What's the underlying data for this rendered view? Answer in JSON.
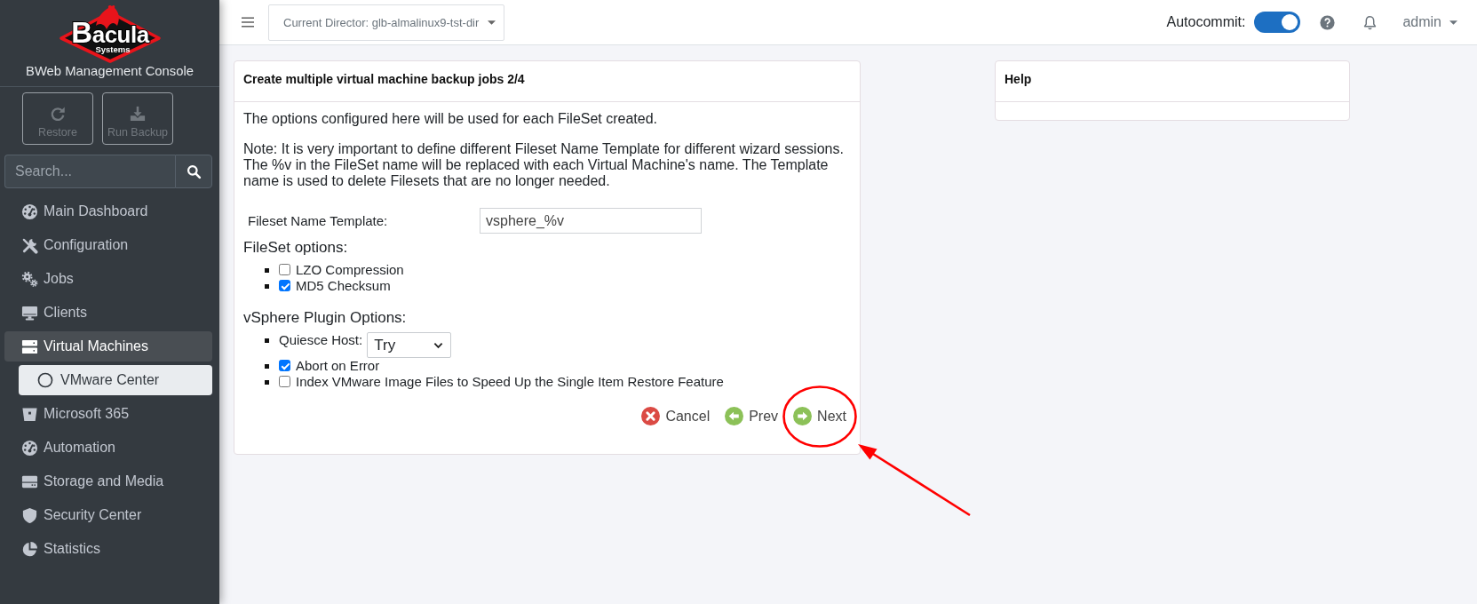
{
  "sidebar": {
    "logo": {
      "wordmark": "Bacula",
      "tagline": "Systems"
    },
    "title": "BWeb Management Console",
    "actions": [
      {
        "label": "Restore",
        "disabled": true
      },
      {
        "label": "Run Backup",
        "disabled": true
      }
    ],
    "search": {
      "placeholder": "Search..."
    },
    "menu": [
      {
        "label": "Main Dashboard",
        "selected": false
      },
      {
        "label": "Configuration",
        "selected": false
      },
      {
        "label": "Jobs",
        "selected": false
      },
      {
        "label": "Clients",
        "selected": false
      },
      {
        "label": "Virtual Machines",
        "selected": true,
        "children": [
          {
            "label": "VMware Center",
            "selected": true
          }
        ]
      },
      {
        "label": "Microsoft 365",
        "selected": false
      },
      {
        "label": "Automation",
        "selected": false
      },
      {
        "label": "Storage and Media",
        "selected": false
      },
      {
        "label": "Security Center",
        "selected": false
      },
      {
        "label": "Statistics",
        "selected": false
      }
    ]
  },
  "topbar": {
    "director": "Current Director: glb-almalinux9-tst-dir",
    "autocommit": {
      "label": "Autocommit:",
      "on": true
    },
    "user": "admin"
  },
  "wizard": {
    "title": "Create multiple virtual machine backup jobs 2/4",
    "intro": "The options configured here will be used for each FileSet created.",
    "note": "Note: It is very important to define different Fileset Name Template for different wizard sessions. The %v in the FileSet name will be replaced with each Virtual Machine's name. The Template name is used to delete Filesets that are no longer needed.",
    "fields": [
      {
        "label": "Fileset Name Template:",
        "value": "vsphere_%v"
      }
    ],
    "sections": [
      {
        "heading": "FileSet options:",
        "items": [
          {
            "kind": "checkbox",
            "label": "LZO Compression",
            "checked": false
          },
          {
            "kind": "checkbox",
            "label": "MD5 Checksum",
            "checked": true
          }
        ]
      },
      {
        "heading": "vSphere Plugin Options:",
        "items": [
          {
            "kind": "select",
            "label": "Quiesce Host:",
            "value": "Try"
          },
          {
            "kind": "checkbox",
            "label": "Abort on Error",
            "checked": true
          },
          {
            "kind": "checkbox",
            "label": "Index VMware Image Files to Speed Up the Single Item Restore Feature",
            "checked": false
          }
        ]
      }
    ],
    "buttons": [
      {
        "label": "Cancel",
        "kind": "cancel",
        "highlighted": false
      },
      {
        "label": "Prev",
        "kind": "prev",
        "highlighted": false
      },
      {
        "label": "Next",
        "kind": "next",
        "highlighted": true
      }
    ]
  },
  "help": {
    "title": "Help"
  }
}
